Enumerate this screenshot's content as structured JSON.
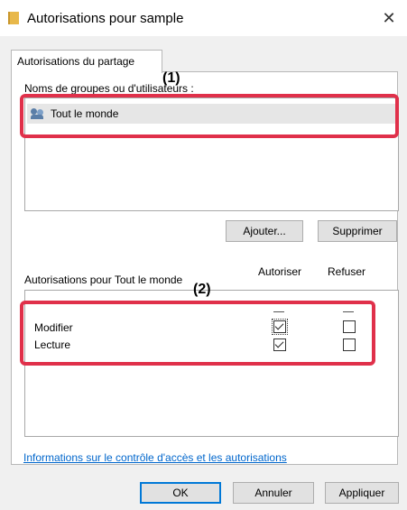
{
  "window": {
    "title": "Autorisations pour sample",
    "close_glyph": "✕"
  },
  "tabs": [
    {
      "label": "Autorisations du partage"
    }
  ],
  "users_section": {
    "label": "Noms de groupes ou d'utilisateurs :",
    "items": [
      {
        "label": "Tout le monde",
        "icon": "users-icon"
      }
    ],
    "add_button": "Ajouter...",
    "remove_button": "Supprimer"
  },
  "permissions_section": {
    "label": "Autorisations pour Tout le monde",
    "col_allow": "Autoriser",
    "col_deny": "Refuser",
    "rows": [
      {
        "label": "Modifier",
        "allow": true,
        "deny": false
      },
      {
        "label": "Lecture",
        "allow": true,
        "deny": false
      }
    ]
  },
  "link_text": "Informations sur le contrôle d'accès et les autorisations",
  "footer": {
    "ok": "OK",
    "cancel": "Annuler",
    "apply": "Appliquer"
  },
  "annotations": {
    "marker1": "(1)",
    "marker2": "(2)",
    "color": "#e0304a"
  }
}
